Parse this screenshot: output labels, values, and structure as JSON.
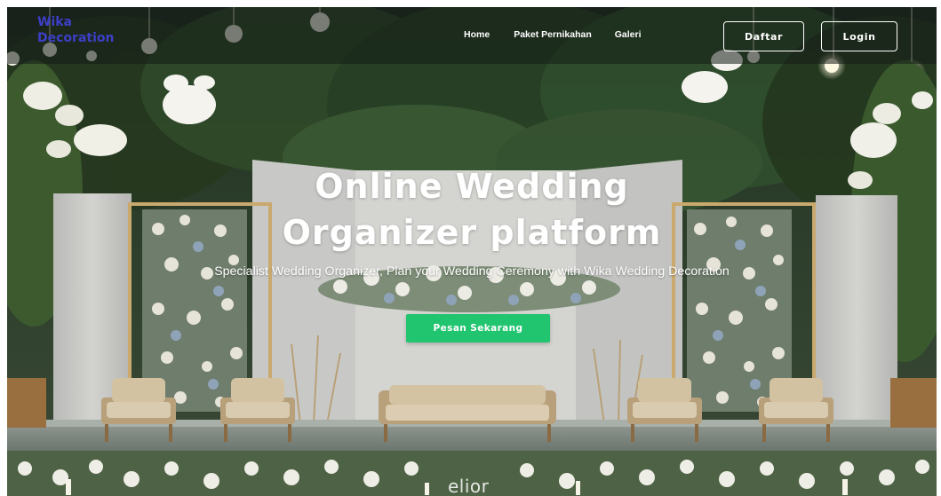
{
  "brand": {
    "line1": "Wika",
    "line2": "Decoration",
    "color": "#3d3fc7"
  },
  "nav": {
    "links": [
      {
        "label": "Home"
      },
      {
        "label": "Paket Pernikahan"
      },
      {
        "label": "Galeri"
      }
    ],
    "register_label": "Daftar",
    "login_label": "Login"
  },
  "hero": {
    "title_line1": "Online Wedding",
    "title_line2": "Organizer platform",
    "subtitle": "Specialist Wedding Organizer, Plan your Wedding Ceremony with Wika Wedding Decoration",
    "cta_label": "Pesan Sekarang",
    "cta_color": "#21c46f",
    "watermark": "elior"
  },
  "icons": [
    "hanging-bulb-icon",
    "flower-icon",
    "sofa-icon",
    "armchair-icon"
  ]
}
